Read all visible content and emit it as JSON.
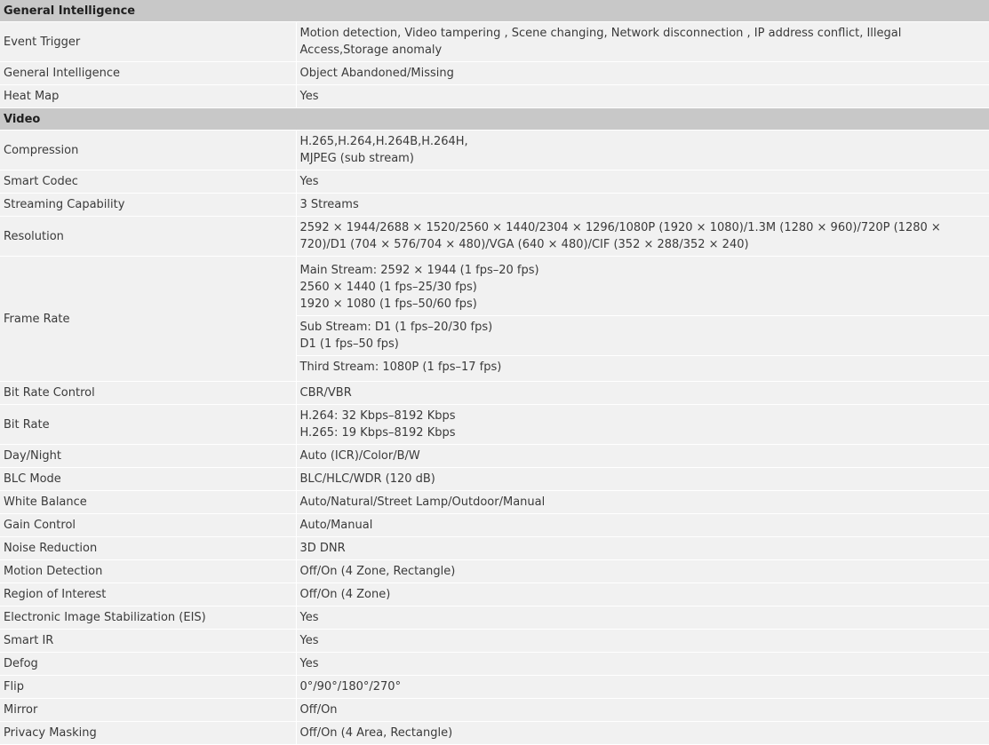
{
  "sections": [
    {
      "title": "General Intelligence",
      "rows": [
        {
          "label": "Event Trigger",
          "value": [
            "Motion detection, Video tampering , Scene changing, Network disconnection , IP address conflict, Illegal Access,Storage anomaly"
          ]
        },
        {
          "label": "General Intelligence",
          "value": [
            "Object Abandoned/Missing"
          ]
        },
        {
          "label": "Heat Map",
          "value": [
            "Yes"
          ]
        }
      ]
    },
    {
      "title": "Video",
      "rows": [
        {
          "label": "Compression",
          "value": [
            "H.265,H.264,H.264B,H.264H,",
            "MJPEG (sub stream)"
          ]
        },
        {
          "label": "Smart Codec",
          "value": [
            "Yes"
          ]
        },
        {
          "label": "Streaming Capability",
          "value": [
            "3 Streams"
          ]
        },
        {
          "label": "Resolution",
          "value": [
            "2592 × 1944/2688 × 1520/2560 × 1440/2304 × 1296/1080P (1920 × 1080)/1.3M (1280 × 960)/720P (1280 × 720)/D1 (704 × 576/704 × 480)/VGA (640 × 480)/CIF (352 × 288/352 × 240)"
          ]
        },
        {
          "label": "Frame Rate",
          "blocks": [
            [
              "Main Stream: 2592 × 1944 (1 fps–20 fps)",
              "2560 × 1440 (1 fps–25/30 fps)",
              "1920 × 1080 (1 fps–50/60 fps)"
            ],
            [
              "Sub Stream: D1 (1 fps–20/30 fps)",
              "D1 (1 fps–50 fps)"
            ],
            [
              "Third Stream: 1080P (1 fps–17 fps)"
            ]
          ]
        },
        {
          "label": "Bit Rate Control",
          "value": [
            "CBR/VBR"
          ]
        },
        {
          "label": "Bit Rate",
          "value": [
            "H.264: 32 Kbps–8192 Kbps",
            "H.265: 19 Kbps–8192 Kbps"
          ]
        },
        {
          "label": "Day/Night",
          "value": [
            "Auto (ICR)/Color/B/W"
          ]
        },
        {
          "label": "BLC Mode",
          "value": [
            "BLC/HLC/WDR (120 dB)"
          ]
        },
        {
          "label": "White Balance",
          "value": [
            "Auto/Natural/Street Lamp/Outdoor/Manual"
          ]
        },
        {
          "label": "Gain Control",
          "value": [
            "Auto/Manual"
          ]
        },
        {
          "label": "Noise Reduction",
          "value": [
            "3D DNR"
          ]
        },
        {
          "label": "Motion Detection",
          "value": [
            "Off/On (4 Zone, Rectangle)"
          ]
        },
        {
          "label": "Region of Interest",
          "value": [
            "Off/On (4 Zone)"
          ]
        },
        {
          "label": "Electronic Image Stabilization (EIS)",
          "value": [
            "Yes"
          ]
        },
        {
          "label": "Smart IR",
          "value": [
            "Yes"
          ]
        },
        {
          "label": "Defog",
          "value": [
            "Yes"
          ]
        },
        {
          "label": "Flip",
          "value": [
            "0°/90°/180°/270°"
          ]
        },
        {
          "label": "Mirror",
          "value": [
            "Off/On"
          ]
        },
        {
          "label": "Privacy Masking",
          "value": [
            "Off/On (4 Area, Rectangle)"
          ]
        }
      ]
    }
  ]
}
